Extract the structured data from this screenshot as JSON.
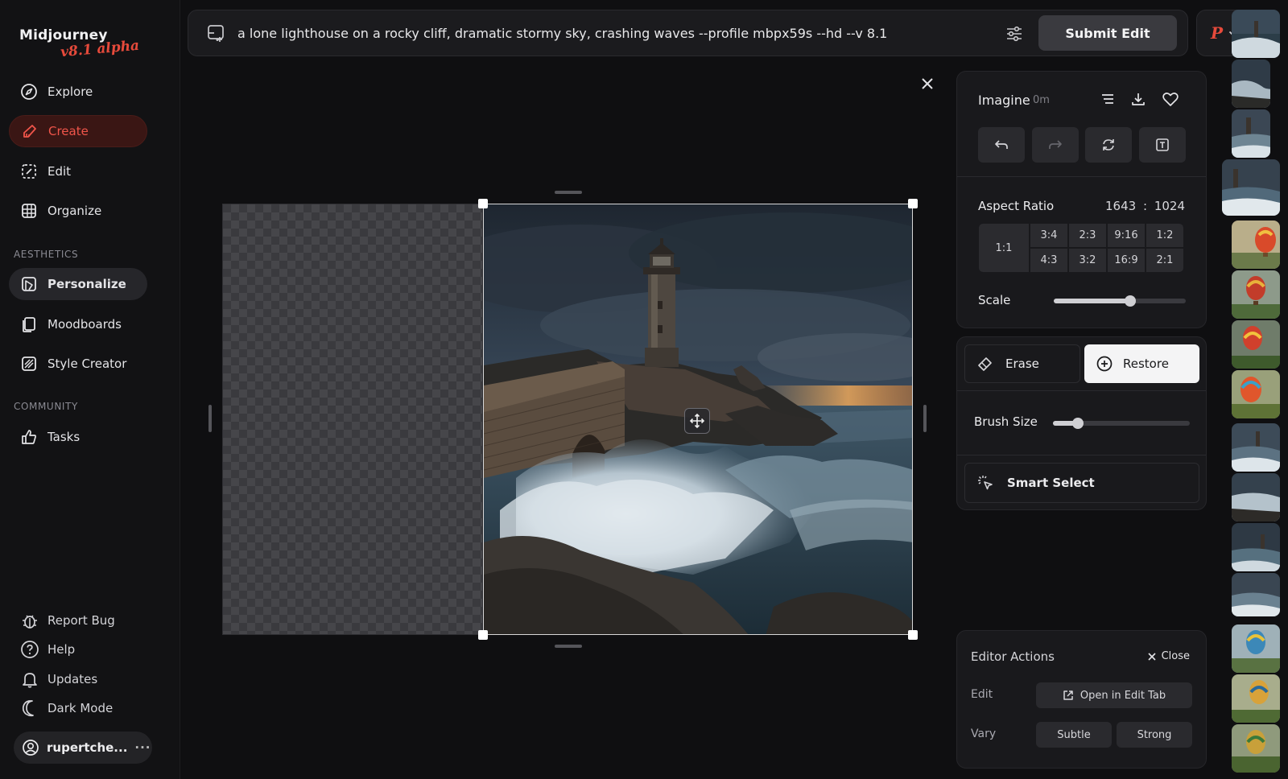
{
  "app": {
    "logo": "Midjourney",
    "version_badge": "v8.1 alpha"
  },
  "sidebar": {
    "items": [
      {
        "label": "Explore",
        "icon": "compass-icon"
      },
      {
        "label": "Create",
        "icon": "brush-icon"
      },
      {
        "label": "Edit",
        "icon": "edit-frame-icon"
      },
      {
        "label": "Organize",
        "icon": "grid-icon"
      }
    ],
    "aesthetics_label": "AESTHETICS",
    "aesthetics_items": [
      {
        "label": "Personalize",
        "icon": "personalize-icon"
      },
      {
        "label": "Moodboards",
        "icon": "moodboard-icon"
      },
      {
        "label": "Style Creator",
        "icon": "style-creator-icon"
      }
    ],
    "community_label": "COMMUNITY",
    "community_items": [
      {
        "label": "Tasks",
        "icon": "thumbs-up-icon"
      }
    ],
    "footer_items": [
      {
        "label": "Report Bug",
        "icon": "bug-icon"
      },
      {
        "label": "Help",
        "icon": "help-icon"
      },
      {
        "label": "Updates",
        "icon": "bell-icon"
      },
      {
        "label": "Dark Mode",
        "icon": "moon-icon"
      }
    ],
    "user": {
      "name": "rupertche...",
      "more": "···"
    }
  },
  "prompt": {
    "text": "a lone lighthouse on a rocky cliff, dramatic stormy sky, crashing waves --profile mbpx59s --hd --v 8.1",
    "submit_label": "Submit Edit",
    "profile_letter": "P"
  },
  "editor": {
    "imagine_label": "Imagine",
    "imagine_time": "0m",
    "aspect_ratio_label": "Aspect Ratio",
    "aspect_width": "1643",
    "aspect_sep": ":",
    "aspect_height": "1024",
    "ratios_top": [
      "3:4",
      "2:3",
      "9:16",
      "1:2"
    ],
    "ratios_bottom": [
      "4:3",
      "3:2",
      "16:9",
      "2:1"
    ],
    "ratio_square": "1:1",
    "scale_label": "Scale",
    "scale_value": 0.58,
    "erase_label": "Erase",
    "restore_label": "Restore",
    "brush_size_label": "Brush Size",
    "brush_size_value": 0.18,
    "smart_select_label": "Smart Select"
  },
  "editor_actions": {
    "title": "Editor Actions",
    "close_label": "Close",
    "edit_label": "Edit",
    "open_edit_tab_label": "Open in Edit Tab",
    "vary_label": "Vary",
    "subtle_label": "Subtle",
    "strong_label": "Strong"
  },
  "colors": {
    "accent": "#e64a3b",
    "background": "#0f0f11",
    "panel": "#19191c"
  }
}
